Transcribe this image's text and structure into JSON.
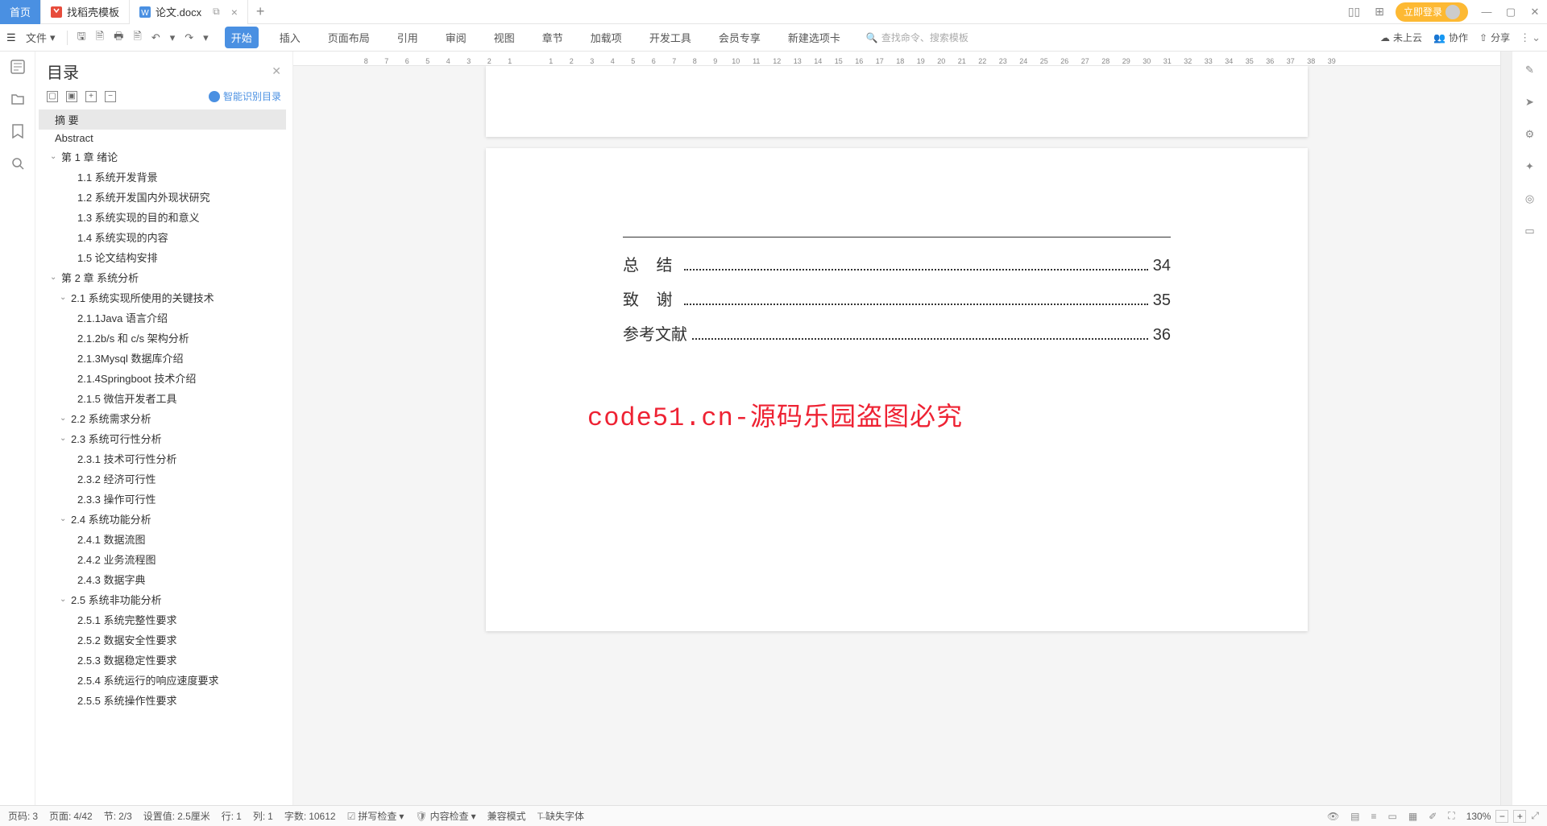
{
  "titlebar": {
    "home": "首页",
    "tab1": "找稻壳模板",
    "tab2": "论文.docx",
    "login": "立即登录"
  },
  "toolbar": {
    "file": "文件",
    "tabs": [
      "开始",
      "插入",
      "页面布局",
      "引用",
      "审阅",
      "视图",
      "章节",
      "加载项",
      "开发工具",
      "会员专享",
      "新建选项卡"
    ],
    "search_placeholder": "查找命令、搜索模板",
    "cloud": "未上云",
    "collab": "协作",
    "share": "分享"
  },
  "outline": {
    "title": "目录",
    "smart": "智能识别目录",
    "items": [
      {
        "label": "摘  要",
        "level": 0,
        "selected": true
      },
      {
        "label": "Abstract",
        "level": 0
      },
      {
        "label": "第 1 章   绪论",
        "level": 1,
        "expand": true
      },
      {
        "label": "1.1 系统开发背景",
        "level": 3
      },
      {
        "label": "1.2 系统开发国内外现状研究",
        "level": 3
      },
      {
        "label": "1.3 系统实现的目的和意义",
        "level": 3
      },
      {
        "label": "1.4 系统实现的内容",
        "level": 3
      },
      {
        "label": "1.5 论文结构安排",
        "level": 3
      },
      {
        "label": "第 2 章   系统分析",
        "level": 1,
        "expand": true
      },
      {
        "label": "2.1 系统实现所使用的关键技术",
        "level": 2,
        "expand": true
      },
      {
        "label": "2.1.1Java 语言介绍",
        "level": 3
      },
      {
        "label": "2.1.2b/s 和 c/s 架构分析",
        "level": 3
      },
      {
        "label": "2.1.3Mysql 数据库介绍",
        "level": 3
      },
      {
        "label": "2.1.4Springboot 技术介绍",
        "level": 3
      },
      {
        "label": "2.1.5 微信开发者工具",
        "level": 3
      },
      {
        "label": "2.2 系统需求分析",
        "level": 2,
        "expand": true
      },
      {
        "label": "2.3 系统可行性分析",
        "level": 2,
        "expand": true
      },
      {
        "label": "2.3.1 技术可行性分析",
        "level": 3
      },
      {
        "label": "2.3.2 经济可行性",
        "level": 3
      },
      {
        "label": "2.3.3 操作可行性",
        "level": 3
      },
      {
        "label": "2.4 系统功能分析",
        "level": 2,
        "expand": true
      },
      {
        "label": "2.4.1 数据流图",
        "level": 3
      },
      {
        "label": "2.4.2 业务流程图",
        "level": 3
      },
      {
        "label": "2.4.3 数据字典",
        "level": 3
      },
      {
        "label": "2.5  系统非功能分析",
        "level": 2,
        "expand": true
      },
      {
        "label": "2.5.1 系统完整性要求",
        "level": 3
      },
      {
        "label": "2.5.2 数据安全性要求",
        "level": 3
      },
      {
        "label": "2.5.3 数据稳定性要求",
        "level": 3
      },
      {
        "label": "2.5.4 系统运行的响应速度要求",
        "level": 3
      },
      {
        "label": "2.5.5 系统操作性要求",
        "level": 3
      }
    ]
  },
  "ruler_ticks": [
    "",
    "8",
    "7",
    "6",
    "5",
    "4",
    "3",
    "2",
    "1",
    "",
    "1",
    "2",
    "3",
    "4",
    "5",
    "6",
    "7",
    "8",
    "9",
    "10",
    "11",
    "12",
    "13",
    "14",
    "15",
    "16",
    "17",
    "18",
    "19",
    "20",
    "21",
    "22",
    "23",
    "24",
    "25",
    "26",
    "27",
    "28",
    "29",
    "30",
    "31",
    "32",
    "33",
    "34",
    "35",
    "36",
    "37",
    "38",
    "39"
  ],
  "doc": {
    "toc": [
      {
        "title": "总   结",
        "page": "34",
        "spaced": true
      },
      {
        "title": "致   谢",
        "page": "35",
        "spaced": true
      },
      {
        "title": "参考文献",
        "page": "36",
        "spaced": false
      }
    ],
    "watermark": "code51.cn-源码乐园盗图必究"
  },
  "statusbar": {
    "page_label": "页码:",
    "page_no": "3",
    "pages_label": "页面:",
    "pages": "4/42",
    "section_label": "节:",
    "section": "2/3",
    "setval_label": "设置值:",
    "setval": "2.5厘米",
    "row_label": "行:",
    "row": "1",
    "col_label": "列:",
    "col": "1",
    "words_label": "字数:",
    "words": "10612",
    "spellcheck": "拼写检查",
    "contentcheck": "内容检查",
    "compat": "兼容模式",
    "missing_font": "缺失字体",
    "zoom": "130%"
  }
}
